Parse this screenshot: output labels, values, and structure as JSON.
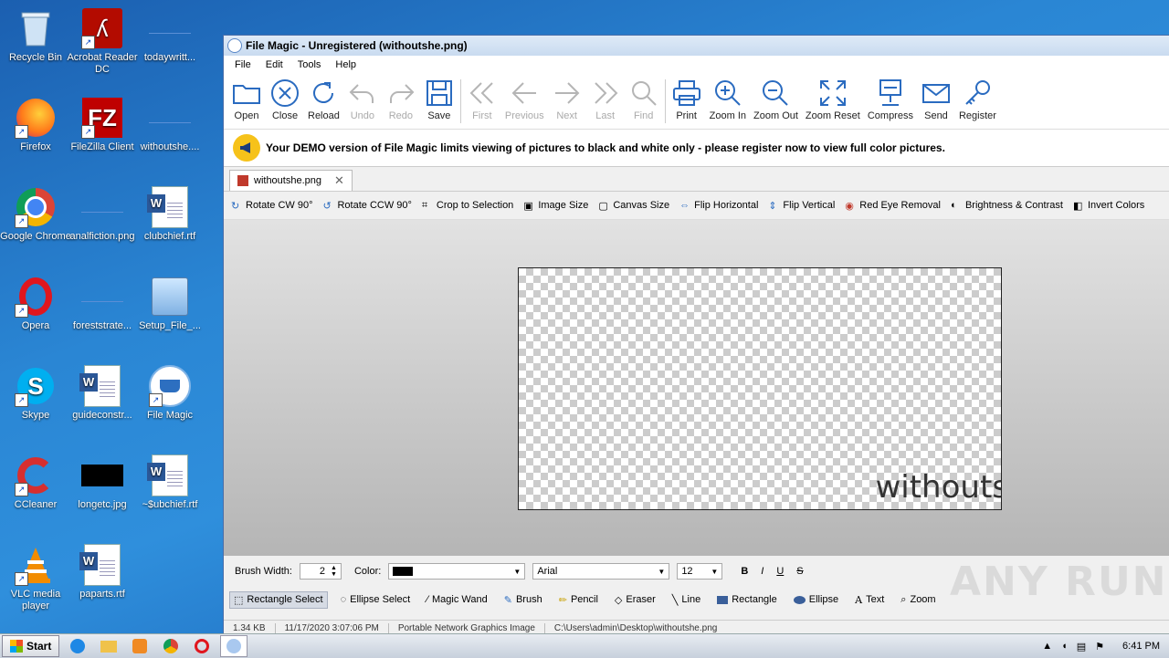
{
  "desktop": {
    "icons": [
      {
        "label": "Recycle Bin"
      },
      {
        "label": "Acrobat Reader DC"
      },
      {
        "label": "todaywritt..."
      },
      {
        "label": "Firefox"
      },
      {
        "label": "FileZilla Client"
      },
      {
        "label": "withoutshe...."
      },
      {
        "label": "Google Chrome"
      },
      {
        "label": "analfiction.png"
      },
      {
        "label": "clubchief.rtf"
      },
      {
        "label": "Opera"
      },
      {
        "label": "foreststrate..."
      },
      {
        "label": "Setup_File_..."
      },
      {
        "label": "Skype"
      },
      {
        "label": "guideconstr..."
      },
      {
        "label": "File Magic"
      },
      {
        "label": "CCleaner"
      },
      {
        "label": "longetc.jpg"
      },
      {
        "label": "~$ubchief.rtf"
      },
      {
        "label": "VLC media player"
      },
      {
        "label": "paparts.rtf"
      }
    ]
  },
  "window": {
    "title": "File Magic - Unregistered (withoutshe.png)",
    "menu": [
      "File",
      "Edit",
      "Tools",
      "Help"
    ],
    "toolbar": [
      {
        "label": "Open",
        "icon": "folder-icon",
        "enabled": true
      },
      {
        "label": "Close",
        "icon": "close-circle-icon",
        "enabled": true
      },
      {
        "label": "Reload",
        "icon": "reload-icon",
        "enabled": true
      },
      {
        "label": "Undo",
        "icon": "undo-icon",
        "enabled": false
      },
      {
        "label": "Redo",
        "icon": "redo-icon",
        "enabled": false
      },
      {
        "label": "Save",
        "icon": "save-icon",
        "enabled": true
      },
      {
        "label": "First",
        "icon": "first-icon",
        "enabled": false
      },
      {
        "label": "Previous",
        "icon": "previous-icon",
        "enabled": false
      },
      {
        "label": "Next",
        "icon": "next-icon",
        "enabled": false
      },
      {
        "label": "Last",
        "icon": "last-icon",
        "enabled": false
      },
      {
        "label": "Find",
        "icon": "find-icon",
        "enabled": false
      },
      {
        "label": "Print",
        "icon": "print-icon",
        "enabled": true
      },
      {
        "label": "Zoom In",
        "icon": "zoom-in-icon",
        "enabled": true
      },
      {
        "label": "Zoom Out",
        "icon": "zoom-out-icon",
        "enabled": true
      },
      {
        "label": "Zoom Reset",
        "icon": "zoom-reset-icon",
        "enabled": true
      },
      {
        "label": "Compress",
        "icon": "compress-icon",
        "enabled": true
      },
      {
        "label": "Send",
        "icon": "send-icon",
        "enabled": true
      },
      {
        "label": "Register",
        "icon": "key-icon",
        "enabled": true
      }
    ],
    "banner": "Your DEMO version of File Magic limits viewing of pictures to black and white only - please register now to view full color pictures.",
    "tab": {
      "label": "withoutshe.png"
    },
    "image_tools": [
      "Rotate CW 90°",
      "Rotate CCW 90°",
      "Crop to Selection",
      "Image Size",
      "Canvas Size",
      "Flip Horizontal",
      "Flip Vertical",
      "Red Eye Removal",
      "Brightness & Contrast",
      "Invert Colors"
    ],
    "picture_text": "withouts",
    "brush": {
      "width_label": "Brush Width:",
      "width_value": "2",
      "color_label": "Color:",
      "color": "#000000",
      "font": "Arial",
      "font_size": "12",
      "format_buttons": [
        "B",
        "I",
        "U",
        "S"
      ]
    },
    "draw_tools": [
      "Rectangle Select",
      "Ellipse Select",
      "Magic Wand",
      "Brush",
      "Pencil",
      "Eraser",
      "Line",
      "Rectangle",
      "Ellipse",
      "Text",
      "Zoom"
    ],
    "status": [
      "1.34 KB",
      "11/17/2020 3:07:06 PM",
      "Portable Network Graphics Image",
      "C:\\Users\\admin\\Desktop\\withoutshe.png"
    ]
  },
  "taskbar": {
    "start_label": "Start",
    "clock": "6:41 PM"
  },
  "watermark": "ANY RUN"
}
